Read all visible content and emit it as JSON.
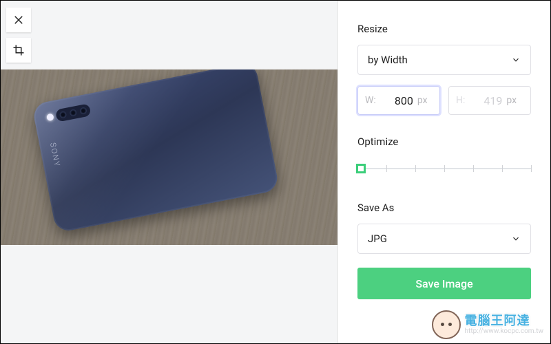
{
  "resize": {
    "label": "Resize",
    "mode": "by Width",
    "width_label": "W:",
    "width_value": "800",
    "height_label": "H:",
    "height_value": "419",
    "unit": "px"
  },
  "optimize": {
    "label": "Optimize",
    "value": 0,
    "ticks": 7
  },
  "save_as": {
    "label": "Save As",
    "format": "JPG"
  },
  "actions": {
    "save_label": "Save Image"
  },
  "watermark": {
    "title": "電腦王阿達",
    "url": "http://www.kocpc.com.tw"
  },
  "preview": {
    "brand_text": "SONY"
  }
}
